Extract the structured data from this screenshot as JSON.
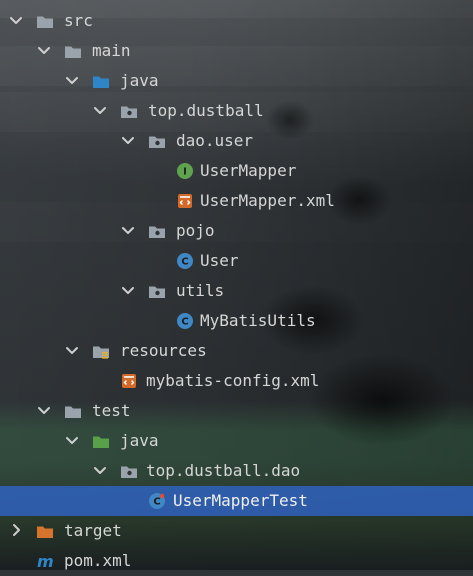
{
  "project_tree": {
    "items": [
      {
        "label": "src",
        "icon": "folder-icon",
        "expanded": true,
        "level": 0
      },
      {
        "label": "main",
        "icon": "folder-icon",
        "expanded": true,
        "level": 1
      },
      {
        "label": "java",
        "icon": "folder-source-icon",
        "expanded": true,
        "level": 2
      },
      {
        "label": "top.dustball",
        "icon": "package-icon",
        "expanded": true,
        "level": 3
      },
      {
        "label": "dao.user",
        "icon": "package-icon",
        "expanded": true,
        "level": 4
      },
      {
        "label": "UserMapper",
        "icon": "interface-icon",
        "level": 5
      },
      {
        "label": "UserMapper.xml",
        "icon": "xml-file-icon",
        "level": 5
      },
      {
        "label": "pojo",
        "icon": "package-icon",
        "expanded": true,
        "level": 4
      },
      {
        "label": "User",
        "icon": "class-icon",
        "level": 5
      },
      {
        "label": "utils",
        "icon": "package-icon",
        "expanded": true,
        "level": 4
      },
      {
        "label": "MyBatisUtils",
        "icon": "class-icon",
        "level": 5
      },
      {
        "label": "resources",
        "icon": "resources-folder-icon",
        "expanded": true,
        "level": 2
      },
      {
        "label": "mybatis-config.xml",
        "icon": "xml-file-icon",
        "level": 3
      },
      {
        "label": "test",
        "icon": "folder-icon",
        "expanded": true,
        "level": 1
      },
      {
        "label": "java",
        "icon": "folder-test-icon",
        "expanded": true,
        "level": 2
      },
      {
        "label": "top.dustball.dao",
        "icon": "package-icon",
        "expanded": true,
        "level": 3
      },
      {
        "label": "UserMapperTest",
        "icon": "test-class-icon",
        "level": 4,
        "selected": true
      },
      {
        "label": "target",
        "icon": "folder-excluded-icon",
        "expanded": false,
        "level": 0
      },
      {
        "label": "pom.xml",
        "icon": "maven-icon",
        "level": 0
      }
    ]
  },
  "colors": {
    "selected_bg": "#2f65ca",
    "folder": "#9aa3ab",
    "source_folder": "#2f86c6",
    "test_folder": "#58a04a",
    "excluded_folder": "#d6732c",
    "class_badge": "#3f88c5",
    "interface_badge": "#5fa34f",
    "xml_badge": "#d46a2a"
  }
}
